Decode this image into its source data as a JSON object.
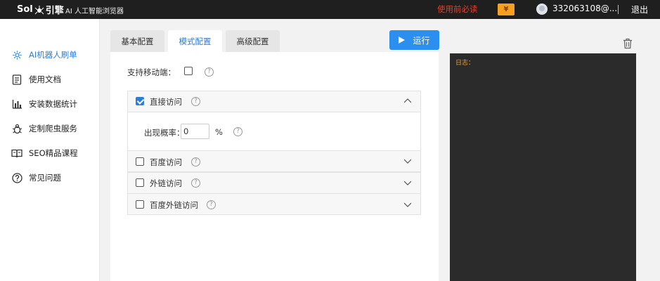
{
  "topbar": {
    "logo_text_left": "Sol",
    "logo_text_right": "引擎",
    "app_title": "AI 人工智能浏览器",
    "warning": "使用前必读",
    "wallet_symbol": "¥",
    "username": "332063108@...",
    "logout": "退出",
    "colors": {
      "background": "#1f1f1f",
      "warning": "#e0412c",
      "wallet": "#f5a01f"
    }
  },
  "sidebar": {
    "items": [
      {
        "label": "AI机器人刷单",
        "icon": "gear-icon",
        "active": true
      },
      {
        "label": "使用文档",
        "icon": "document-icon",
        "active": false
      },
      {
        "label": "安装数据统计",
        "icon": "bar-chart-icon",
        "active": false
      },
      {
        "label": "定制爬虫服务",
        "icon": "bug-icon",
        "active": false
      },
      {
        "label": "SEO精品课程",
        "icon": "book-icon",
        "active": false
      },
      {
        "label": "常见问题",
        "icon": "question-icon",
        "active": false
      }
    ]
  },
  "tabs": [
    {
      "label": "基本配置",
      "active": false
    },
    {
      "label": "模式配置",
      "active": true
    },
    {
      "label": "高级配置",
      "active": false
    }
  ],
  "run_button": {
    "label": "运行",
    "icon": "play-icon"
  },
  "mode": {
    "mobile_label": "支持移动端：",
    "mobile_checked": false,
    "help_symbol": "?",
    "sections": [
      {
        "label": "直接访问",
        "checked": true,
        "expanded": true
      },
      {
        "label": "百度访问",
        "checked": false,
        "expanded": false
      },
      {
        "label": "外链访问",
        "checked": false,
        "expanded": false
      },
      {
        "label": "百度外链访问",
        "checked": false,
        "expanded": false
      }
    ],
    "rate_label": "出现概率：",
    "rate_value": "0",
    "rate_unit": "%"
  },
  "log": {
    "label": "日志："
  },
  "accent_color": "#2b7fd8"
}
